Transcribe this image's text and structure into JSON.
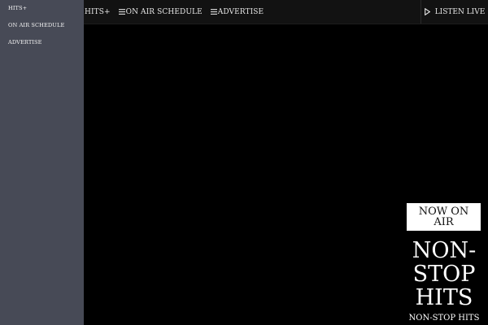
{
  "nav": {
    "items": [
      {
        "label": "HITS+",
        "icon": ""
      },
      {
        "label": "ON AIR SCHEDULE",
        "icon": "menu-lines-icon"
      },
      {
        "label": "ADVERTISE",
        "icon": "menu-lines-icon"
      }
    ],
    "listen_label": "LISTEN LIVE",
    "listen_icon": "play-icon"
  },
  "drawer": {
    "items": [
      {
        "label": "HITS+"
      },
      {
        "label": "ON AIR SCHEDULE"
      },
      {
        "label": "ADVERTISE"
      }
    ]
  },
  "on_air": {
    "badge": "NOW ON AIR",
    "show_title": "NON-STOP HITS",
    "show_subtitle": "NON-STOP HITS"
  },
  "colors": {
    "background": "#000000",
    "topbar": "#121212",
    "drawer": "#474a56",
    "text": "#e6e6e6",
    "badge_bg": "#ffffff"
  }
}
